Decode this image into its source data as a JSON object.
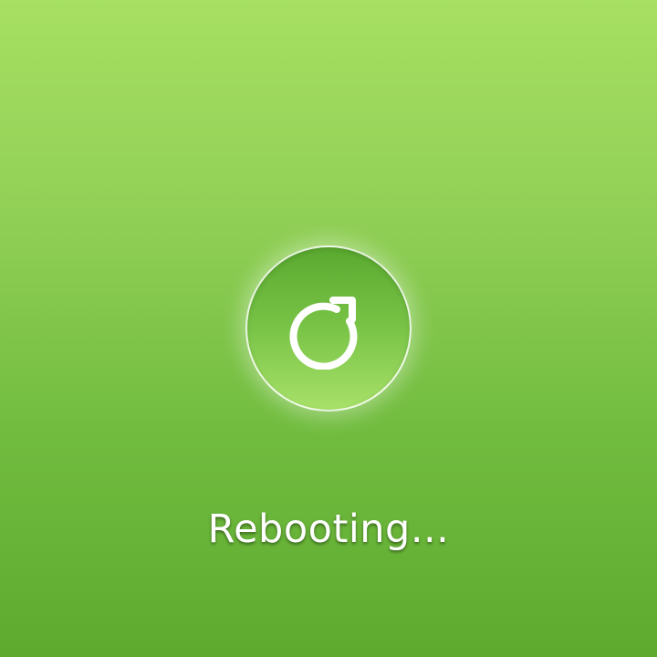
{
  "status": {
    "message": "Rebooting..."
  },
  "icon": {
    "name": "reboot-icon",
    "color": "#ffffff"
  },
  "theme": {
    "background_top": "#a7e062",
    "background_bottom": "#5daa2f",
    "circle_top": "#5aa92f",
    "circle_bottom": "#a8e16a"
  }
}
